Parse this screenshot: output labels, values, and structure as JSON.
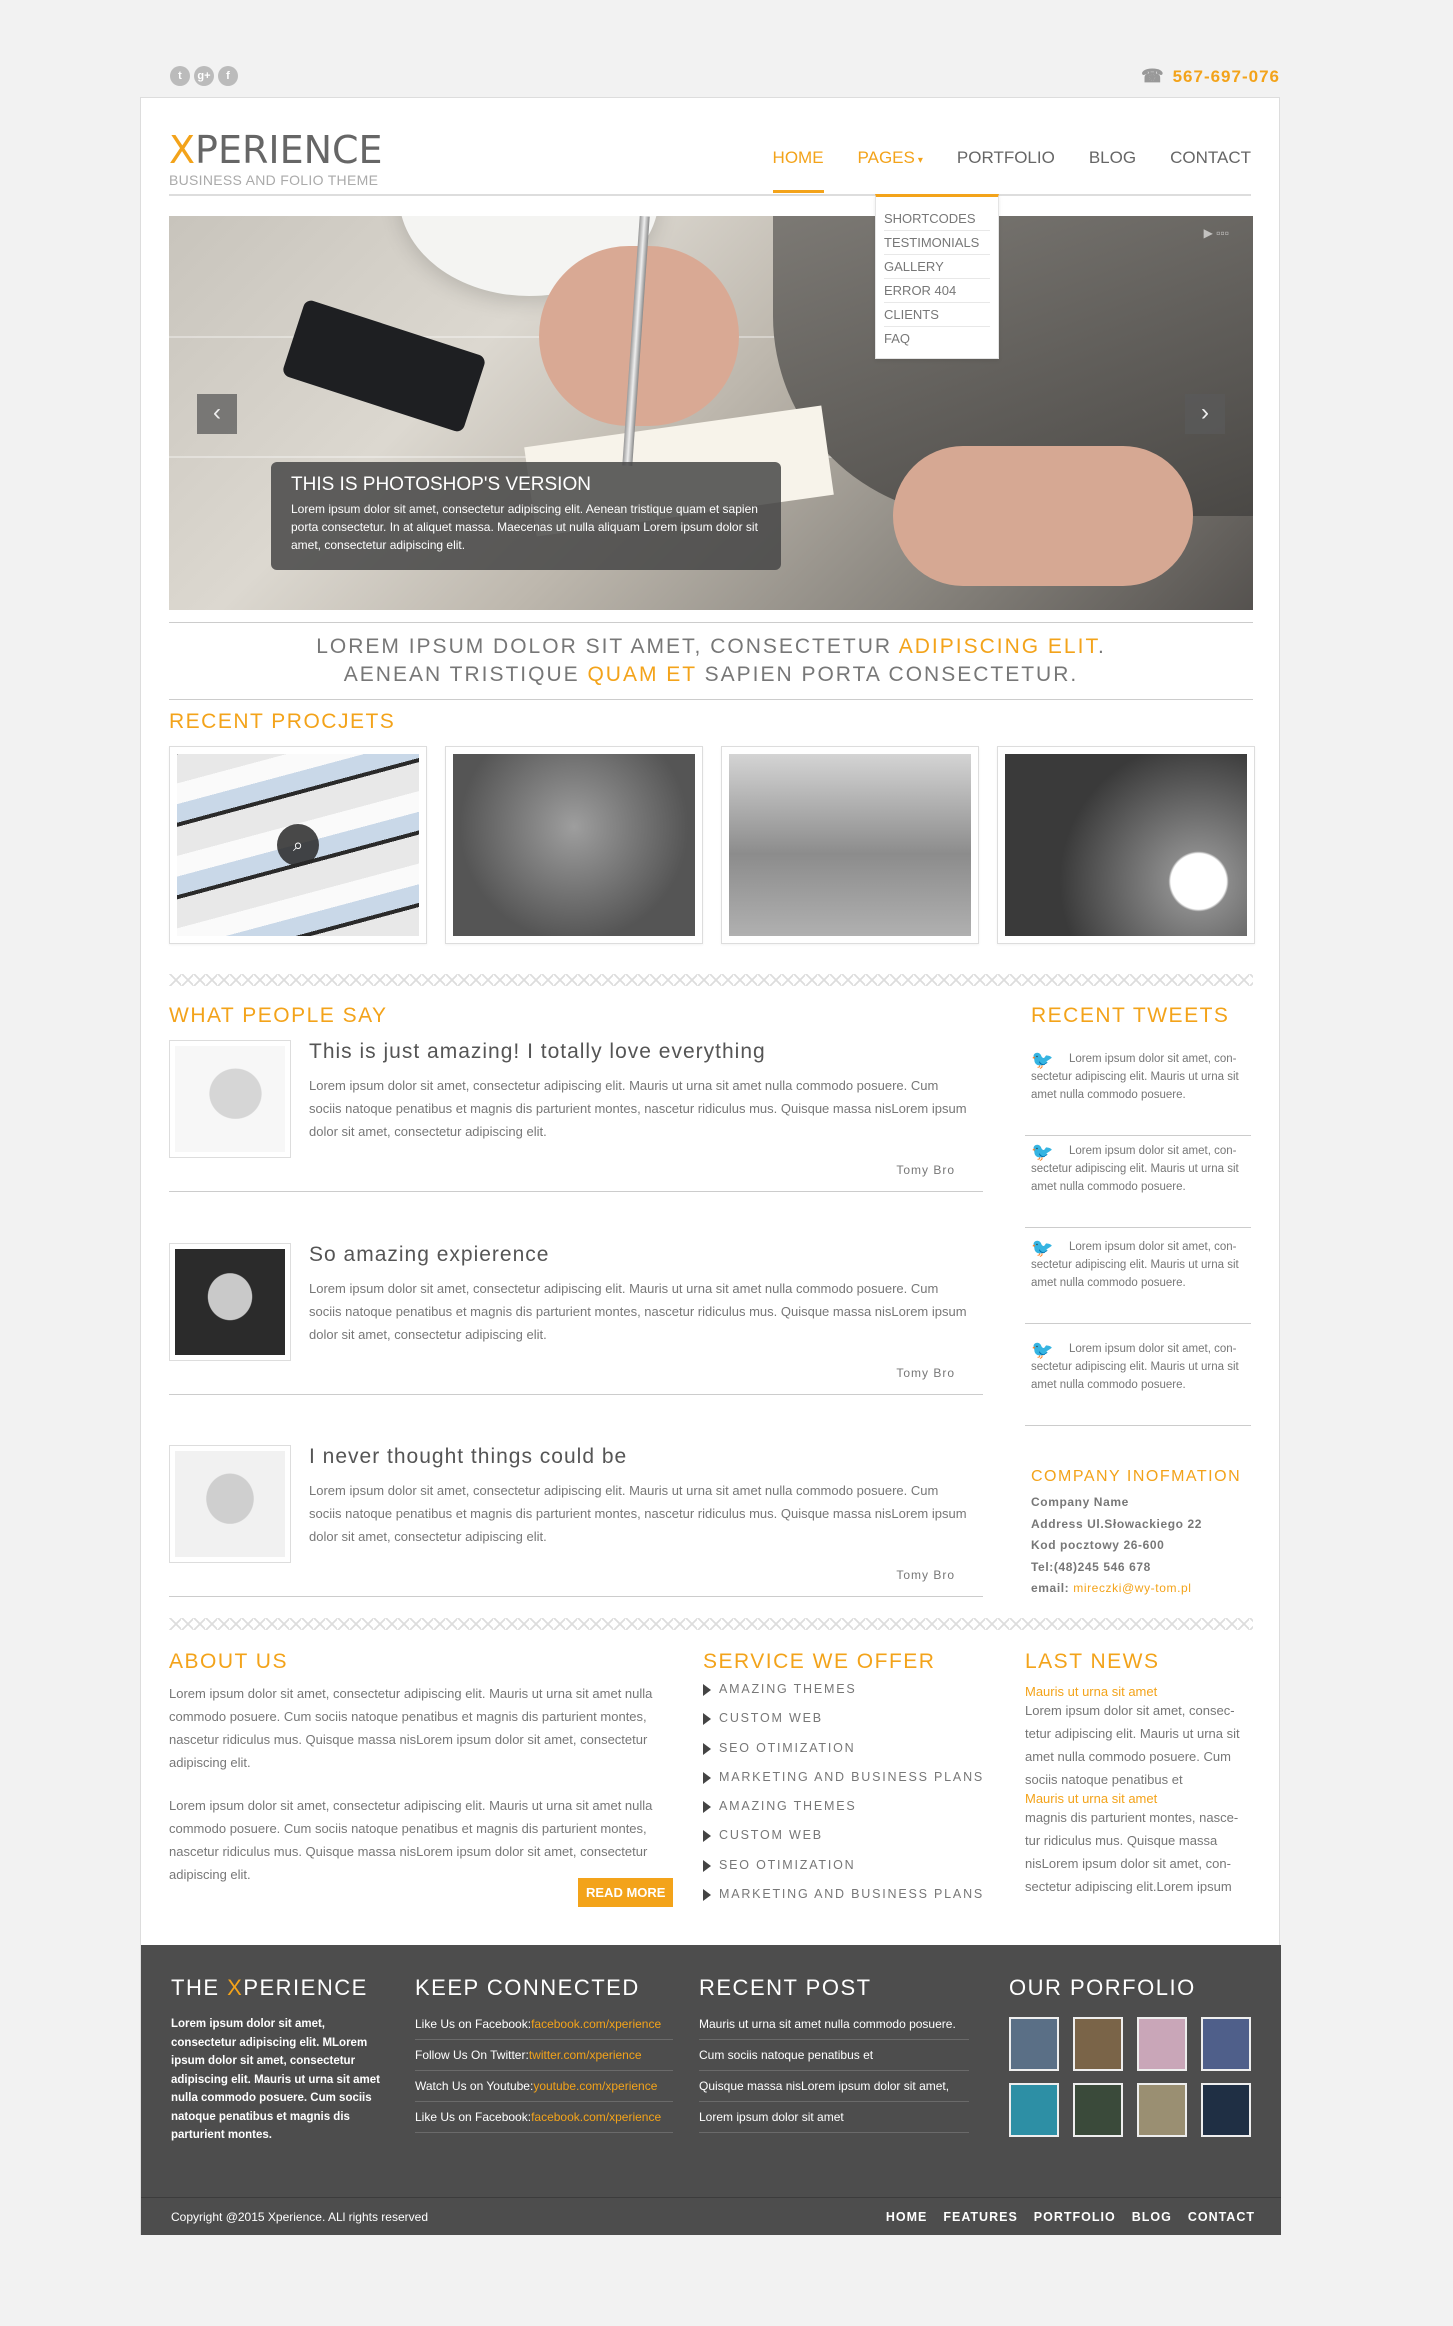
{
  "topbar": {
    "social": [
      "t",
      "g+",
      "f"
    ],
    "phone": "567-697-076"
  },
  "logo": {
    "brand_x": "X",
    "brand_rest": "PERIENCE",
    "tagline": "BUSINESS AND FOLIO THEME"
  },
  "nav": {
    "home": "HOME",
    "pages": "PAGES",
    "portfolio": "PORTFOLIO",
    "blog": "BLOG",
    "contact": "CONTACT"
  },
  "dropdown": [
    "SHORTCODES",
    "TESTIMONIALS",
    "GALLERY",
    "ERROR 404",
    "CLIENTS",
    "FAQ"
  ],
  "slider": {
    "title": "THIS IS PHOTOSHOP'S VERSION",
    "text": "Lorem ipsum dolor sit amet, consectetur adipiscing elit. Aenean tristique quam et sapien porta consectetur. In at aliquet massa. Maecenas ut nulla aliquam Lorem ipsum dolor sit amet, consectetur adipiscing elit."
  },
  "tagline": {
    "l1a": "LOREM IPSUM DOLOR SIT AMET, CONSECTETUR ",
    "l1b": "ADIPISCING ELIT",
    "l1c": ".",
    "l2a": "AENEAN TRISTIQUE ",
    "l2b": "QUAM ET",
    "l2c": " SAPIEN PORTA CONSECTETUR."
  },
  "sections": {
    "recent_projects": "RECENT PROCJETS",
    "what_people_say": "WHAT PEOPLE SAY",
    "recent_tweets": "RECENT TWEETS",
    "about_us": "ABOUT US",
    "services": "SERVICE WE OFFER",
    "last_news": "LAST NEWS"
  },
  "testimonials": [
    {
      "title": "This is just amazing! I totally love everything",
      "text": "Lorem ipsum dolor sit amet, consectetur adipiscing elit. Mauris ut urna sit amet nulla commodo posuere. Cum sociis natoque penatibus et magnis dis parturient montes, nascetur ridiculus mus. Quisque massa nisLorem ipsum dolor sit amet, consectetur adipiscing elit.",
      "author": "Tomy Bro"
    },
    {
      "title": "So amazing expierence",
      "text": "Lorem ipsum dolor sit amet, consectetur adipiscing elit. Mauris ut urna sit amet nulla commodo posuere. Cum sociis natoque penatibus et magnis dis parturient montes, nascetur ridiculus mus. Quisque massa nisLorem ipsum dolor sit amet, consectetur adipiscing elit.",
      "author": "Tomy Bro"
    },
    {
      "title": "I never thought things could be",
      "text": "Lorem ipsum dolor sit amet, consectetur adipiscing elit. Mauris ut urna sit amet nulla commodo posuere. Cum sociis natoque penatibus et magnis dis parturient montes, nascetur ridiculus mus. Quisque massa nisLorem ipsum dolor sit amet, consectetur adipiscing elit.",
      "author": "Tomy Bro"
    }
  ],
  "tweets": [
    "Lorem ipsum dolor sit amet, con-sectetur adipiscing elit. Mauris ut urna sit amet nulla commodo posuere.",
    "Lorem ipsum dolor sit amet, con-sectetur adipiscing elit. Mauris ut urna sit amet nulla commodo posuere.",
    "Lorem ipsum dolor sit amet, con-sectetur adipiscing elit. Mauris ut urna sit amet nulla commodo posuere.",
    "Lorem ipsum dolor sit amet, con-sectetur adipiscing elit. Mauris ut urna sit amet nulla commodo posuere."
  ],
  "company": {
    "title": "COMPANY INOFMATION",
    "name": "Company Name",
    "address": "Address Ul.Słowackiego 22",
    "postcode": "Kod pocztowy 26-600",
    "tel": "Tel:(48)245 546 678",
    "email_label": "email: ",
    "email": "mireczki@wy-tom.pl"
  },
  "about": {
    "p1": "Lorem ipsum dolor sit amet, consectetur adipiscing elit. Mauris ut urna sit amet nulla commodo posuere. Cum sociis natoque penatibus et magnis dis parturient montes, nascetur ridiculus mus. Quisque massa nisLorem ipsum dolor sit amet, consectetur adipiscing elit.",
    "p2": "Lorem ipsum dolor sit amet, consectetur adipiscing elit. Mauris ut urna sit amet nulla commodo posuere. Cum sociis natoque penatibus et magnis dis parturient montes, nascetur ridiculus mus. Quisque massa nisLorem ipsum dolor sit amet, consectetur adipiscing elit.",
    "readmore": "READ MORE"
  },
  "services": [
    "AMAZING THEMES",
    "CUSTOM WEB",
    "SEO OTIMIZATION",
    "MARKETING AND BUSINESS PLANS",
    "AMAZING THEMES",
    "CUSTOM WEB",
    "SEO OTIMIZATION",
    "MARKETING AND BUSINESS PLANS"
  ],
  "news": {
    "link1": "Mauris ut urna sit amet",
    "text1": "Lorem ipsum dolor sit amet, consec-tetur adipiscing elit. Mauris ut urna sit amet nulla commodo posuere. Cum sociis natoque penatibus et",
    "link2": "Mauris ut urna sit amet",
    "text2": "magnis dis parturient montes, nasce-tur ridiculus mus. Quisque massa nisLorem ipsum dolor sit amet, con-sectetur adipiscing elit.Lorem ipsum"
  },
  "footer": {
    "the": "THE ",
    "x": "X",
    "perience": "PERIENCE",
    "about_text": "Lorem ipsum dolor sit amet, consectetur adipiscing elit. MLorem ipsum dolor sit amet, consectetur adipiscing elit. Mauris ut urna sit amet nulla commodo posuere. Cum sociis natoque penatibus et magnis dis parturient montes.",
    "keep_title": "KEEP CONNECTED",
    "keep": [
      {
        "label": "Like Us on Facebook:",
        "link": "facebook.com/xperience"
      },
      {
        "label": "Follow Us On Twitter:",
        "link": "twitter.com/xperience"
      },
      {
        "label": "Watch Us on Youtube:",
        "link": "youtube.com/xperience"
      },
      {
        "label": "Like Us on Facebook:",
        "link": "facebook.com/xperience"
      }
    ],
    "recent_title": "RECENT POST",
    "recent": [
      "Mauris ut urna sit amet nulla commodo posuere.",
      "Cum sociis natoque penatibus et",
      "Quisque massa nisLorem ipsum dolor sit amet,",
      "Lorem ipsum dolor sit amet"
    ],
    "portfolio_title": "OUR PORFOLIO",
    "thumb_colors": [
      "#5a6f86",
      "#7a6448",
      "#c9a6b8",
      "#4f5f8a",
      "#2d8fa5",
      "#3a4a3a",
      "#9a8f72",
      "#1f2f44"
    ],
    "copyright": "Copyright @2015 Xperience. ALl rights reserved",
    "nav": [
      "HOME",
      "FEATURES",
      "PORTFOLIO",
      "BLOG",
      "CONTACT"
    ]
  }
}
